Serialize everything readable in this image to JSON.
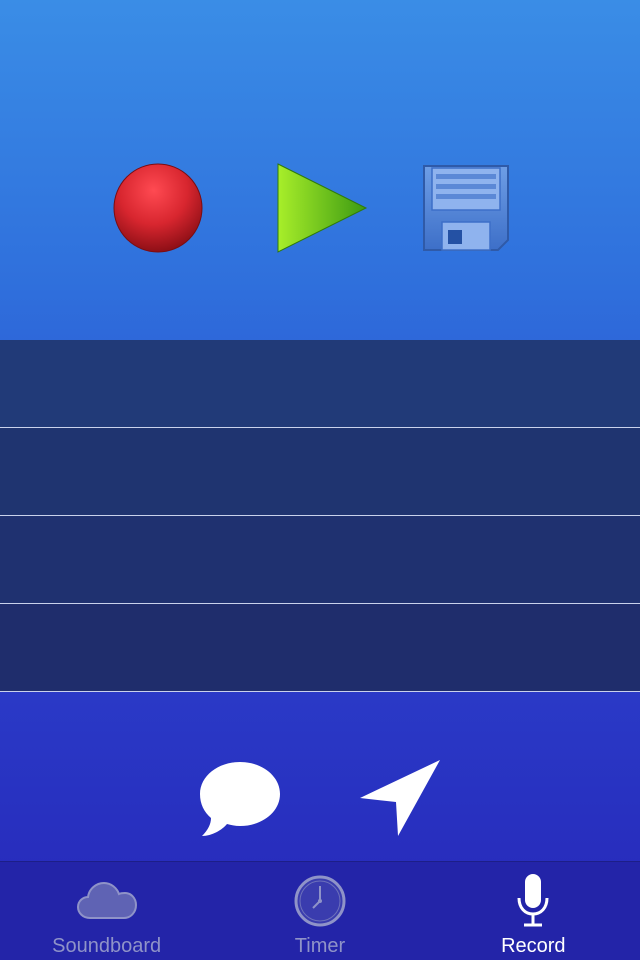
{
  "controls": {
    "record_icon": "record-circle",
    "play_icon": "play-triangle",
    "save_icon": "floppy-disk"
  },
  "recordings": [
    "",
    "",
    "",
    ""
  ],
  "actions": {
    "message_icon": "speech-bubble",
    "send_icon": "location-arrow"
  },
  "tabbar": {
    "tabs": [
      {
        "label": "Soundboard",
        "icon": "cloud",
        "active": false
      },
      {
        "label": "Timer",
        "icon": "clock",
        "active": false
      },
      {
        "label": "Record",
        "icon": "microphone",
        "active": true
      }
    ]
  },
  "colors": {
    "accent_active": "#ffffff",
    "tab_inactive": "#8f93c8",
    "list_row": "#213a78",
    "record_red": "#d8262f",
    "play_green": "#7fd21f",
    "save_blue": "#4f86d8"
  }
}
